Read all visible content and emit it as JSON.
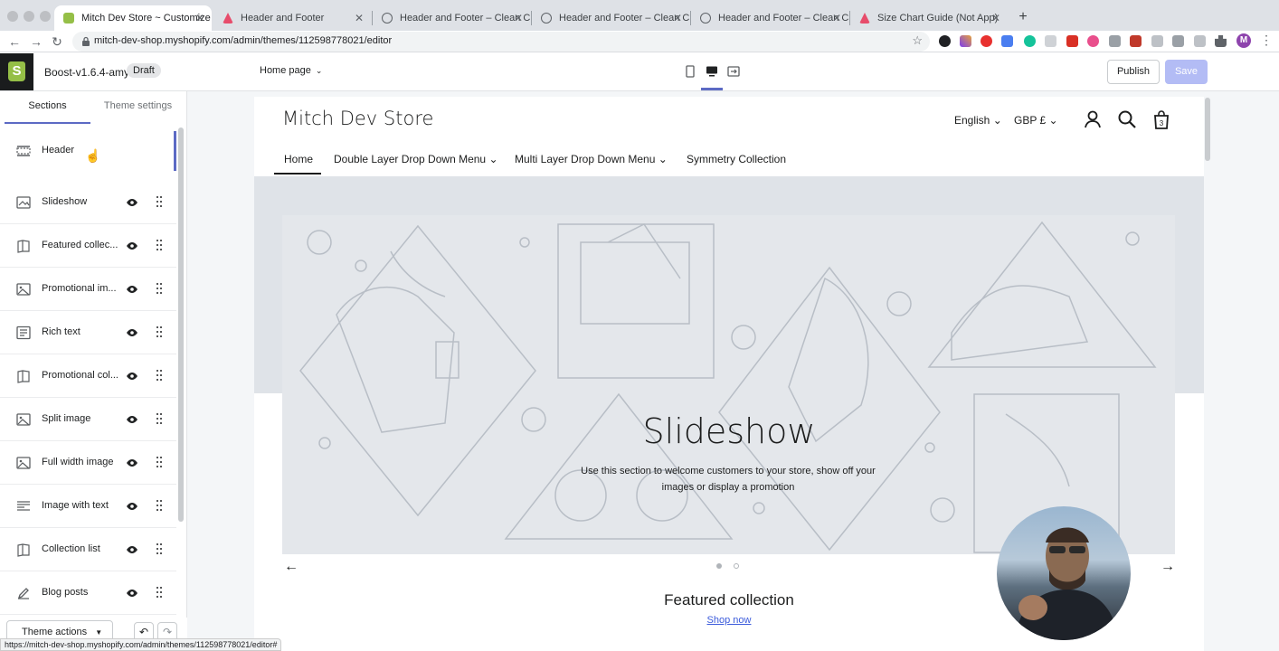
{
  "browser": {
    "tabs": [
      {
        "title": "Mitch Dev Store ~ Customize",
        "active": true
      },
      {
        "title": "Header and Footer",
        "active": false
      },
      {
        "title": "Header and Footer – Clean Can",
        "active": false
      },
      {
        "title": "Header and Footer – Clean Can",
        "active": false
      },
      {
        "title": "Header and Footer – Clean Can",
        "active": false
      },
      {
        "title": "Size Chart Guide (Not App)",
        "active": false
      }
    ],
    "url": "mitch-dev-shop.myshopify.com/admin/themes/112598778021/editor",
    "profile_initial": "M",
    "status_url": "https://mitch-dev-shop.myshopify.com/admin/themes/112598778021/editor#"
  },
  "editor": {
    "theme_name": "Boost-v1.6.4-amy",
    "badge": "Draft",
    "page_selector": "Home page",
    "publish_label": "Publish",
    "save_label": "Save",
    "accent": "#5c6ac4"
  },
  "sidebar": {
    "tabs": [
      "Sections",
      "Theme settings"
    ],
    "header_item": "Header",
    "sections": [
      {
        "label": "Slideshow",
        "icon": "slideshow-icon"
      },
      {
        "label": "Featured collec...",
        "icon": "collection-icon"
      },
      {
        "label": "Promotional im...",
        "icon": "image-icon"
      },
      {
        "label": "Rich text",
        "icon": "text-icon"
      },
      {
        "label": "Promotional col...",
        "icon": "collection-icon"
      },
      {
        "label": "Split image",
        "icon": "image-icon"
      },
      {
        "label": "Full width image",
        "icon": "image-icon"
      },
      {
        "label": "Image with text",
        "icon": "image-text-icon"
      },
      {
        "label": "Collection list",
        "icon": "collection-icon"
      },
      {
        "label": "Blog posts",
        "icon": "blog-icon"
      }
    ],
    "theme_actions": "Theme actions"
  },
  "store": {
    "name": "Mitch Dev Store",
    "language": "English",
    "currency": "GBP £",
    "cart_count": "3",
    "nav": [
      "Home",
      "Double Layer Drop Down Menu",
      "Multi Layer Drop Down Menu",
      "Symmetry Collection"
    ],
    "hero_title": "Slideshow",
    "hero_text": "Use this section to welcome customers to your store, show off your images or display a promotion",
    "featured_title": "Featured collection",
    "featured_link": "Shop now"
  }
}
